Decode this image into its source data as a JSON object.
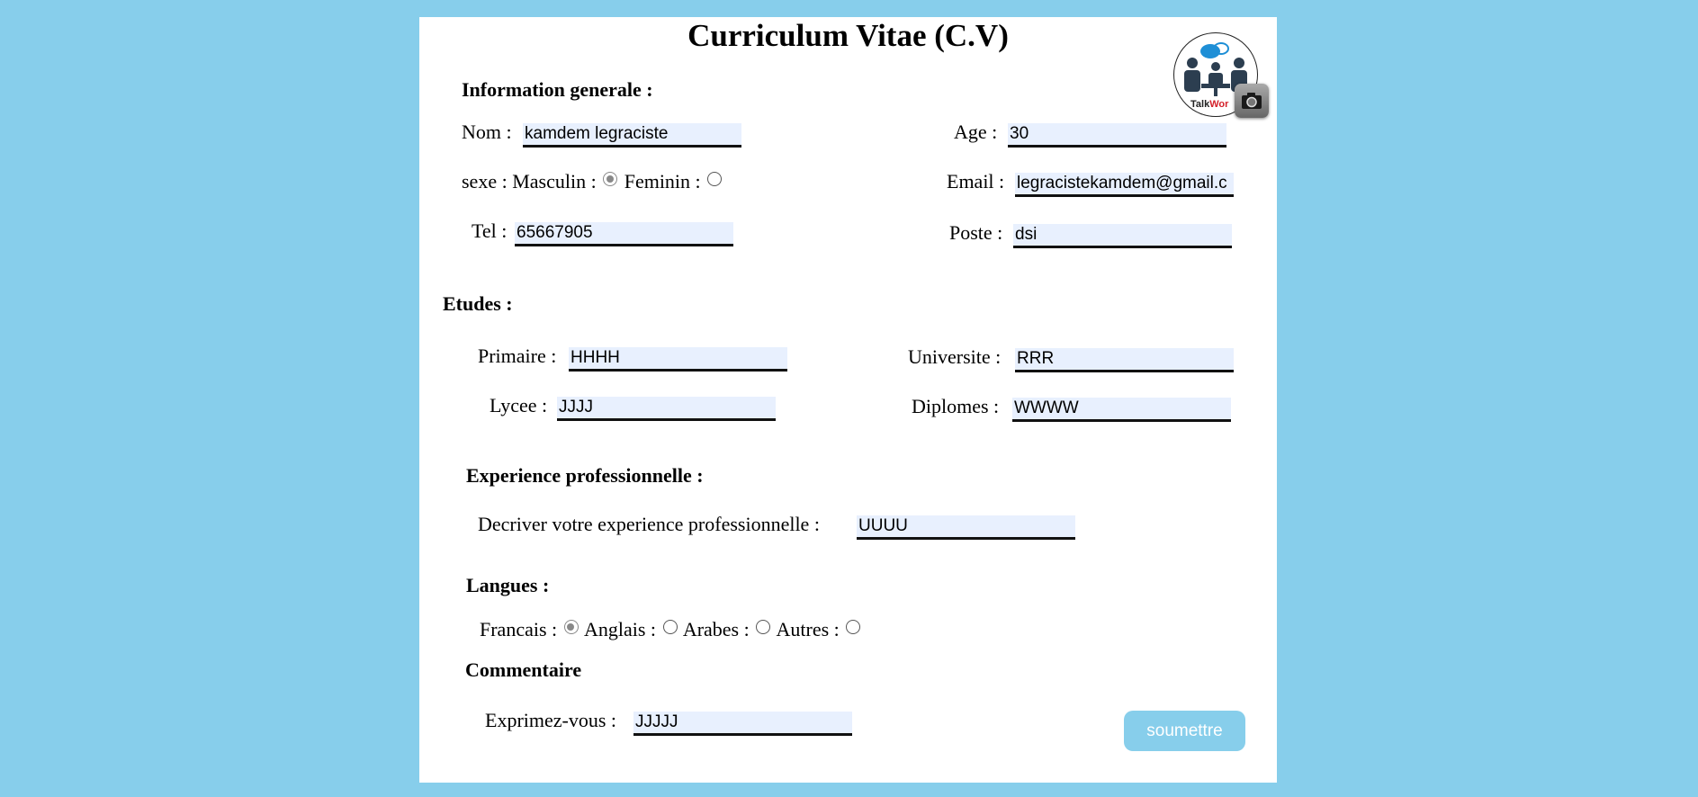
{
  "title": "Curriculum Vitae (C.V)",
  "logo": {
    "text_a": "Talk",
    "text_b": "Wor"
  },
  "info": {
    "heading": "Information generale :",
    "nom_label": "Nom :",
    "nom_value": "kamdem legraciste",
    "age_label": "Age :",
    "age_value": "30",
    "sexe_label": "sexe : Masculin :",
    "feminin_label": "Feminin :",
    "email_label": "Email :",
    "email_value": "legracistekamdem@gmail.c",
    "tel_label": "Tel :",
    "tel_value": "65667905",
    "poste_label": "Poste :",
    "poste_value": "dsi"
  },
  "etudes": {
    "heading": "Etudes :",
    "primaire_label": "Primaire :",
    "primaire_value": "HHHH",
    "universite_label": "Universite :",
    "universite_value": "RRR",
    "lycee_label": "Lycee :",
    "lycee_value": "JJJJ",
    "diplomes_label": "Diplomes :",
    "diplomes_value": "WWWW"
  },
  "experience": {
    "heading": "Experience professionnelle :",
    "label": "Decriver votre experience professionnelle :",
    "value": "UUUU"
  },
  "langues": {
    "heading": "Langues :",
    "francais_label": "Francais :",
    "anglais_label": "Anglais :",
    "arabes_label": "Arabes :",
    "autres_label": "Autres :"
  },
  "commentaire": {
    "heading": "Commentaire",
    "label": "Exprimez-vous :",
    "value": "JJJJJ"
  },
  "submit_label": "soumettre"
}
